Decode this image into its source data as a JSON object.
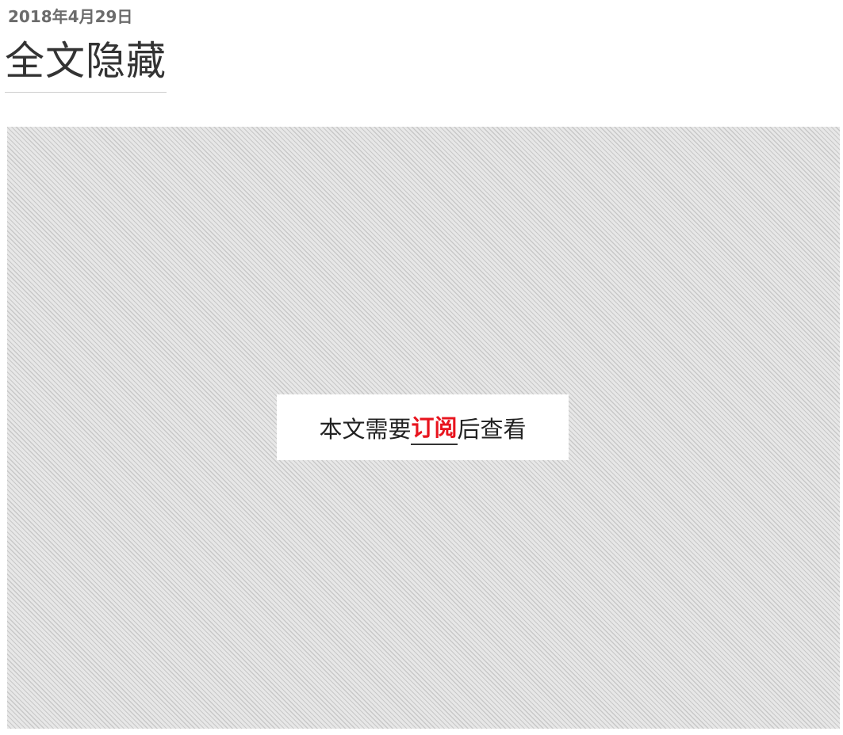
{
  "post": {
    "date": "2018年4月29日",
    "title": "全文隐藏"
  },
  "paywall": {
    "text_before": "本文需要",
    "link_text": "订阅",
    "text_after": "后查看"
  },
  "colors": {
    "link": "#e8141e",
    "date": "#6b6b6b",
    "title": "#333333"
  }
}
